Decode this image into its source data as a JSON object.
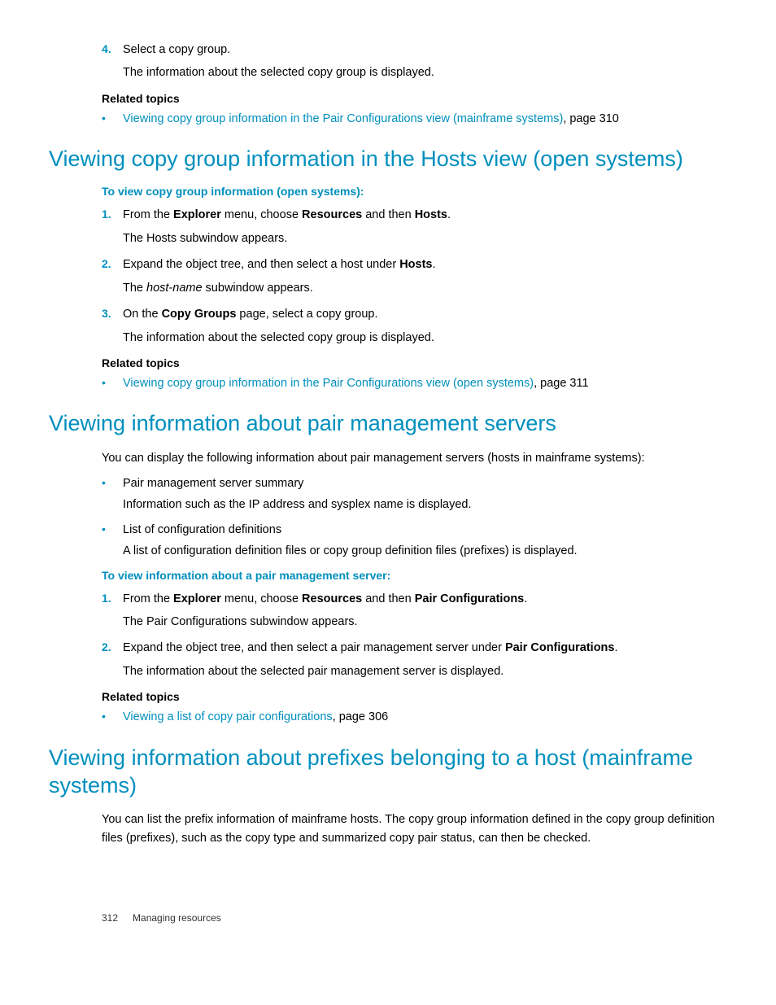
{
  "top": {
    "step4_num": "4.",
    "step4_text": "Select a copy group.",
    "step4_sub": "The information about the selected copy group is displayed.",
    "related_label": "Related topics",
    "related_link": "Viewing copy group information in the Pair Configurations view (mainframe systems)",
    "related_page": ", page 310"
  },
  "sec1": {
    "heading": "Viewing copy group information in the Hosts view (open systems)",
    "subhead": "To view copy group information (open systems):",
    "steps": {
      "n1": "1.",
      "t1a": "From the ",
      "t1b": "Explorer",
      "t1c": " menu, choose ",
      "t1d": "Resources",
      "t1e": " and then ",
      "t1f": "Hosts",
      "t1g": ".",
      "s1": "The Hosts subwindow appears.",
      "n2": "2.",
      "t2a": "Expand the object tree, and then select a host under ",
      "t2b": "Hosts",
      "t2c": ".",
      "s2a": "The ",
      "s2b": "host-name",
      "s2c": " subwindow appears.",
      "n3": "3.",
      "t3a": "On the ",
      "t3b": "Copy Groups",
      "t3c": " page, select a copy group.",
      "s3": "The information about the selected copy group is displayed."
    },
    "related_label": "Related topics",
    "related_link": "Viewing copy group information in the Pair Configurations view (open systems)",
    "related_page": ", page 311"
  },
  "sec2": {
    "heading": "Viewing information about pair management servers",
    "intro": "You can display the following information about pair management servers (hosts in mainframe systems):",
    "b1": "Pair management server summary",
    "b1s": "Information such as the IP address and sysplex name is displayed.",
    "b2": "List of configuration definitions",
    "b2s": "A list of configuration definition files or copy group definition files (prefixes) is displayed.",
    "subhead": "To view information about a pair management server:",
    "steps": {
      "n1": "1.",
      "t1a": "From the ",
      "t1b": "Explorer",
      "t1c": " menu, choose ",
      "t1d": "Resources",
      "t1e": " and then ",
      "t1f": "Pair Configurations",
      "t1g": ".",
      "s1": "The Pair Configurations subwindow appears.",
      "n2": "2.",
      "t2a": "Expand the object tree, and then select a pair management server under ",
      "t2b": "Pair Configurations",
      "t2c": ".",
      "s2": "The information about the selected pair management server is displayed."
    },
    "related_label": "Related topics",
    "related_link": "Viewing a list of copy pair configurations",
    "related_page": ", page 306"
  },
  "sec3": {
    "heading": "Viewing information about prefixes belonging to a host (mainframe systems)",
    "intro": "You can list the prefix information of mainframe hosts. The copy group information defined in the copy group definition files (prefixes), such as the copy type and summarized copy pair status, can then be checked."
  },
  "footer": {
    "page": "312",
    "title": "Managing resources"
  }
}
